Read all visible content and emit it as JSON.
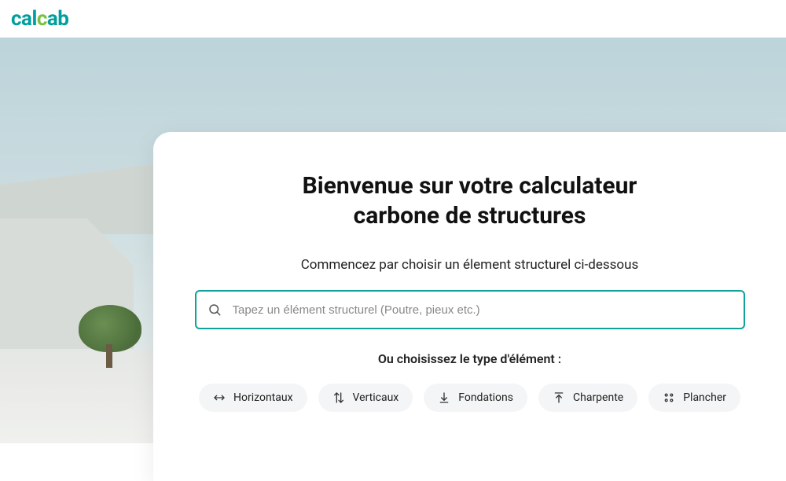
{
  "brand": {
    "part1": "cal",
    "part2": "c",
    "part3": "ab"
  },
  "colors": {
    "accent": "#0fa29a",
    "brand_teal": "#009e9e",
    "brand_green": "#7ac142"
  },
  "hero": {
    "title_line1": "Bienvenue sur votre calculateur",
    "title_line2": "carbone de structures",
    "subtitle": "Commencez par choisir un élement structurel ci-dessous",
    "search_placeholder": "Tapez un élément structurel (Poutre, pieux etc.)",
    "or_label": "Ou choisissez le type d'élément :"
  },
  "categories": [
    {
      "id": "horizontaux",
      "label": "Horizontaux",
      "icon": "arrows-horizontal"
    },
    {
      "id": "verticaux",
      "label": "Verticaux",
      "icon": "arrows-vertical"
    },
    {
      "id": "fondations",
      "label": "Fondations",
      "icon": "arrow-down-bar"
    },
    {
      "id": "charpente",
      "label": "Charpente",
      "icon": "arrow-up-bar"
    },
    {
      "id": "plancher",
      "label": "Plancher",
      "icon": "grid-dots"
    }
  ]
}
